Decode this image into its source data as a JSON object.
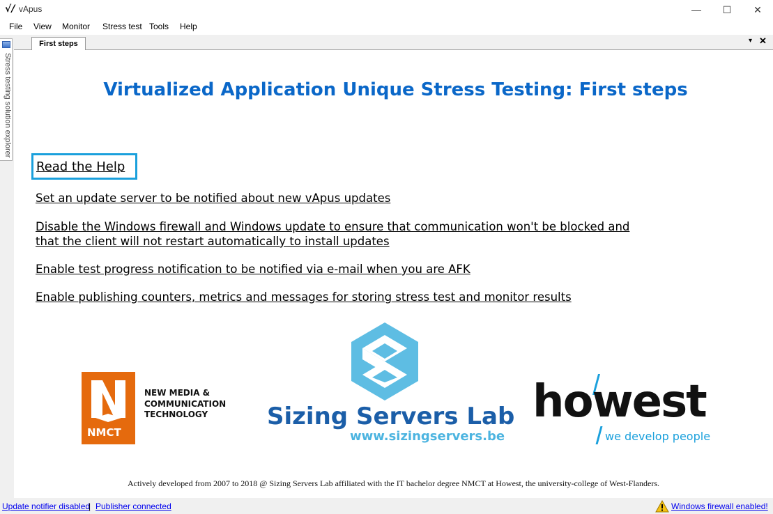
{
  "window": {
    "app_icon": "√/",
    "title": "vApus",
    "minimize": "—",
    "maximize": "☐",
    "close": "✕"
  },
  "menu": {
    "items": [
      "File",
      "View",
      "Monitor",
      "Stress test",
      "Tools",
      "Help"
    ]
  },
  "sidebar": {
    "tab_label": "Stress testing solution explorer",
    "icon": "solution-explorer-icon"
  },
  "tabs": {
    "active": "First steps",
    "dropdown": "▾",
    "close": "✕"
  },
  "main": {
    "heading": "Virtualized Application Unique Stress Testing: First steps",
    "links": [
      "Read the Help",
      "Set an update server to be notified about new vApus updates",
      "Disable the Windows firewall and Windows update to ensure that communication won't be blocked and that the client will not restart automatically to install updates",
      "Enable test progress notification to be notified via e-mail when you are AFK",
      "Enable publishing counters, metrics and messages for storing stress test and monitor results"
    ],
    "logos": {
      "nmct_mark": "NMCT",
      "nmct_line1": "NEW MEDIA &",
      "nmct_line2": "COMMUNICATION",
      "nmct_line3": "TECHNOLOGY",
      "ssl_name": "Sizing Servers Lab",
      "ssl_url": "www.sizingservers.be",
      "howest_name": "howest",
      "howest_tagline": "we develop people"
    },
    "footer": "Actively developed from 2007 to 2018 @ Sizing Servers Lab affiliated with the IT bachelor degree NMCT at Howest, the university-college of West-Flanders."
  },
  "status": {
    "update_notifier": "Update notifier disabled",
    "separator": "|",
    "publisher": "Publisher connected",
    "firewall_warning": "Windows firewall enabled!"
  },
  "colors": {
    "heading": "#0a67c8",
    "help_highlight": "#1aa0dc",
    "nmct_orange": "#e56a0d",
    "ssl_blue": "#1b5ea8",
    "ssl_light": "#4cb4e0",
    "link_status": "#0000ee"
  }
}
